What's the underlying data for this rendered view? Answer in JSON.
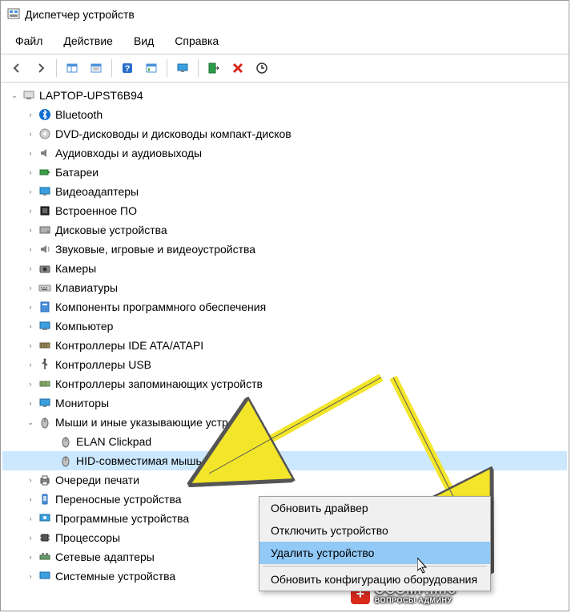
{
  "window": {
    "title": "Диспетчер устройств"
  },
  "menu": {
    "file": "Файл",
    "action": "Действие",
    "view": "Вид",
    "help": "Справка"
  },
  "toolbar_icons": {
    "back": "back-icon",
    "forward": "forward-icon",
    "show_hide": "show-hide-icon",
    "properties": "properties-icon",
    "help": "help-icon",
    "details": "details-icon",
    "monitor": "monitor-icon",
    "install": "install-icon",
    "remove": "remove-icon",
    "scan": "scan-icon"
  },
  "tree": {
    "root": "LAPTOP-UPST6B94",
    "categories": [
      {
        "label": "Bluetooth",
        "icon": "bluetooth"
      },
      {
        "label": "DVD-дисководы и дисководы компакт-дисков",
        "icon": "dvd"
      },
      {
        "label": "Аудиовходы и аудиовыходы",
        "icon": "audio"
      },
      {
        "label": "Батареи",
        "icon": "battery"
      },
      {
        "label": "Видеоадаптеры",
        "icon": "display"
      },
      {
        "label": "Встроенное ПО",
        "icon": "firmware"
      },
      {
        "label": "Дисковые устройства",
        "icon": "disk"
      },
      {
        "label": "Звуковые, игровые и видеоустройства",
        "icon": "sound"
      },
      {
        "label": "Камеры",
        "icon": "camera"
      },
      {
        "label": "Клавиатуры",
        "icon": "keyboard"
      },
      {
        "label": "Компоненты программного обеспечения",
        "icon": "software"
      },
      {
        "label": "Компьютер",
        "icon": "computer"
      },
      {
        "label": "Контроллеры IDE ATA/ATAPI",
        "icon": "ide"
      },
      {
        "label": "Контроллеры USB",
        "icon": "usb"
      },
      {
        "label": "Контроллеры запоминающих устройств",
        "icon": "storage"
      },
      {
        "label": "Мониторы",
        "icon": "monitor"
      },
      {
        "label": "Мыши и иные указывающие устройства",
        "icon": "mouse",
        "expanded": true,
        "children": [
          {
            "label": "ELAN Clickpad",
            "icon": "mouse"
          },
          {
            "label": "HID-совместимая мышь",
            "icon": "mouse",
            "selected": true
          }
        ]
      },
      {
        "label": "Очереди печати",
        "icon": "printer"
      },
      {
        "label": "Переносные устройства",
        "icon": "portable"
      },
      {
        "label": "Программные устройства",
        "icon": "softdev"
      },
      {
        "label": "Процессоры",
        "icon": "cpu"
      },
      {
        "label": "Сетевые адаптеры",
        "icon": "network"
      },
      {
        "label": "Системные устройства",
        "icon": "system"
      }
    ]
  },
  "context_menu": {
    "update_driver": "Обновить драйвер",
    "disable_device": "Отключить устройство",
    "uninstall_device": "Удалить устройство",
    "scan_hardware": "Обновить конфигурацию оборудования"
  },
  "watermark": {
    "main": "OCOMP.info",
    "sub": "ВОПРОСЫ АДМИНУ"
  }
}
